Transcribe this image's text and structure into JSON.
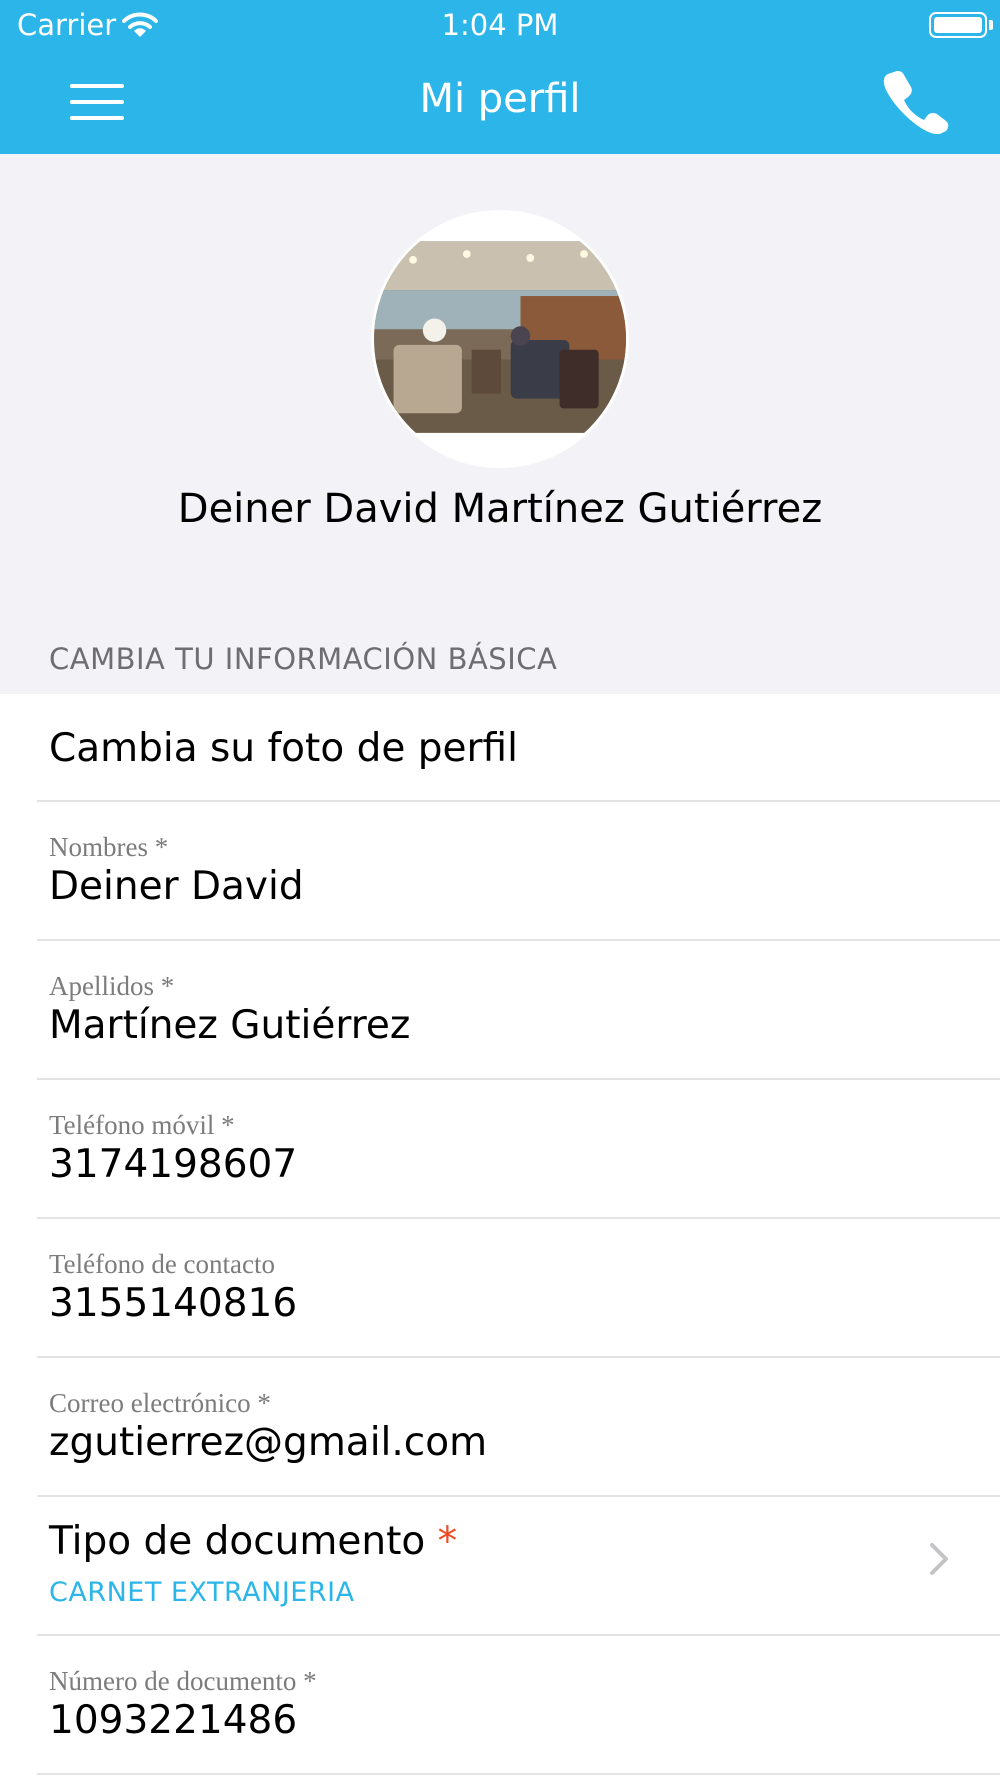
{
  "status_bar": {
    "carrier": "Carrier",
    "time": "1:04 PM"
  },
  "nav": {
    "title": "Mi perfil"
  },
  "profile": {
    "full_name": "Deiner David Martínez Gutiérrez"
  },
  "section": {
    "header": "CAMBIA TU INFORMACIÓN BÁSICA"
  },
  "rows": {
    "change_photo": "Cambia su foto de perfil",
    "nombres": {
      "label": "Nombres *",
      "value": "Deiner David"
    },
    "apellidos": {
      "label": "Apellidos *",
      "value": "Martínez Gutiérrez"
    },
    "telefono_movil": {
      "label": "Teléfono móvil *",
      "value": "3174198607"
    },
    "telefono_contacto": {
      "label": "Teléfono de contacto",
      "value": "3155140816"
    },
    "correo": {
      "label": "Correo electrónico *",
      "value": "zgutierrez@gmail.com"
    },
    "tipo_documento": {
      "label": "Tipo de documento",
      "required_mark": "*",
      "value": "CARNET EXTRANJERIA"
    },
    "numero_documento": {
      "label": "Número de documento *",
      "value": "1093221486"
    }
  },
  "colors": {
    "accent": "#2bb5e8",
    "required": "#f04a22",
    "background": "#f2f2f7"
  },
  "icons": {
    "menu": "hamburger-icon",
    "call": "phone-icon",
    "disclosure": "chevron-right-icon",
    "wifi": "wifi-icon",
    "battery": "battery-icon"
  }
}
